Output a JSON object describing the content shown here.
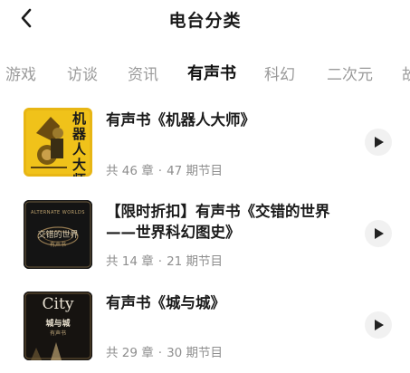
{
  "header": {
    "title": "电台分类"
  },
  "tabs": [
    "游戏",
    "访谈",
    "资讯",
    "有声书",
    "科幻",
    "二次元",
    "故"
  ],
  "active_tab": "有声书",
  "items": [
    {
      "title_lines": [
        "有声书《机器人大师》"
      ],
      "chapters": "共 46 章",
      "programs": "47 期节目",
      "cover": {
        "text": "机器人大师"
      }
    },
    {
      "title_lines": [
        "【限时折扣】有声书《交错的世界",
        "——世界科幻图史》"
      ],
      "chapters": "共 14 章",
      "programs": "21 期节目",
      "cover": {
        "small": "ALTERNATE WORLDS",
        "text": "交错的世界",
        "sub": "有声书"
      }
    },
    {
      "title_lines": [
        "有声书《城与城》"
      ],
      "chapters": "共 29 章",
      "programs": "30 期节目",
      "cover": {
        "big": "City",
        "text": "城与城",
        "sub": "有声书"
      }
    }
  ],
  "colors": {
    "accent": "#111111",
    "muted": "#9a9a9a",
    "cover1": "#e8b614"
  },
  "meta_separator": "·",
  "icons": {
    "back": "chevron-left-icon",
    "play": "play-icon"
  }
}
